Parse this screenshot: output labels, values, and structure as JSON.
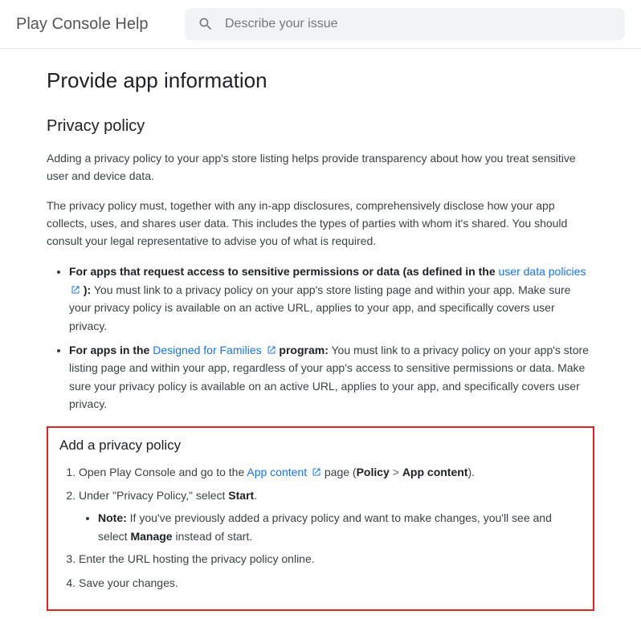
{
  "header": {
    "title": "Play Console Help",
    "search_placeholder": "Describe your issue"
  },
  "page": {
    "title": "Provide app information",
    "section_title": "Privacy policy",
    "para1": "Adding a privacy policy to your app's store listing helps provide transparency about how you treat sensitive user and device data.",
    "para2": "The privacy policy must, together with any in-app disclosures, comprehensively disclose how your app collects, uses, and shares user data. This includes the types of parties with whom it's shared. You should consult your legal representative to advise you of what is required.",
    "bullet1": {
      "lead": "For apps that request access to sensitive permissions or data (as defined in the ",
      "link": "user data policies",
      "after_link": " ):",
      "body": " You must link to a privacy policy on your app's store listing page and within your app. Make sure your privacy policy is available on an active URL, applies to your app, and specifically covers user privacy."
    },
    "bullet2": {
      "lead": "For apps in the ",
      "link": "Designed for Families",
      "program": "  program:",
      "body": " You must link to a privacy policy on your app's store listing page and within your app, regardless of your app's access to sensitive permissions or data. Make sure your privacy policy is available on an active URL, applies to your app, and specifically covers user privacy."
    },
    "callout": {
      "title": "Add a privacy policy",
      "step1_a": "Open Play Console and go to the ",
      "step1_link": "App content",
      "step1_b": "  page (",
      "step1_policy": "Policy",
      "step1_chev": ">",
      "step1_appcontent": "App content",
      "step1_c": ").",
      "step2_a": "Under \"Privacy Policy,\" select ",
      "step2_start": "Start",
      "step2_b": ".",
      "note_label": "Note:",
      "note_a": " If you've previously added a privacy policy and want to make changes, you'll see and select ",
      "note_manage": "Manage",
      "note_b": " instead of start.",
      "step3": "Enter the URL hosting the privacy policy online.",
      "step4": "Save your changes."
    }
  }
}
